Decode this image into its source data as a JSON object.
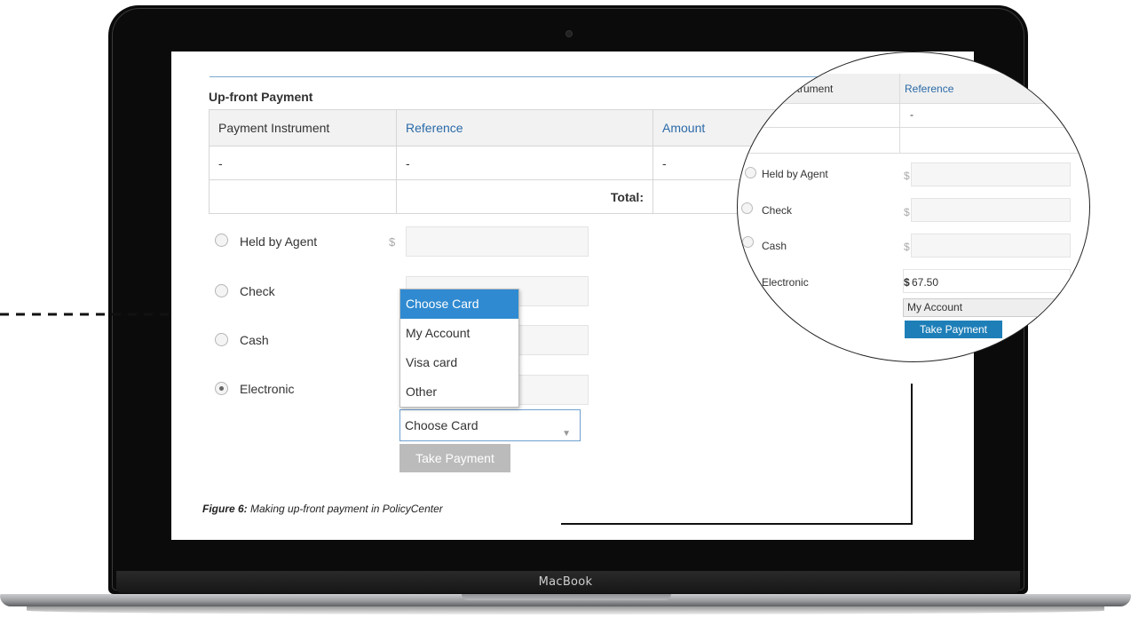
{
  "device": {
    "brand_label": "MacBook"
  },
  "section": {
    "title": "Up-front Payment"
  },
  "table": {
    "headers": [
      "Payment Instrument",
      "Reference",
      "Amount"
    ],
    "row": [
      "-",
      "-",
      "-"
    ],
    "total_label": "Total:"
  },
  "methods": [
    {
      "label": "Held by Agent",
      "currency": "$",
      "checked": false
    },
    {
      "label": "Check",
      "currency": "$",
      "checked": false
    },
    {
      "label": "Cash",
      "currency": "$",
      "checked": false
    },
    {
      "label": "Electronic",
      "currency": "$",
      "checked": true
    }
  ],
  "card_select": {
    "value": "Choose Card",
    "options": [
      "Choose Card",
      "My Account",
      "Visa card",
      "Other"
    ]
  },
  "take_payment_label": "Take Payment",
  "caption": {
    "prefix": "Figure 6:",
    "text": " Making up-front payment in PolicyCenter"
  },
  "zoom": {
    "col_instrument_fragment": "nstrument",
    "col_reference": "Reference",
    "row_value": "-",
    "methods": [
      "Held by Agent",
      "Check",
      "Cash",
      "Electronic"
    ],
    "currency": "$",
    "electronic_amount": "67.50",
    "electronic_currency": "$",
    "selected_card": "My Account",
    "take_payment_label": "Take Payment"
  },
  "colors": {
    "accent": "#2f8ad1",
    "button_active": "#1e7fb8",
    "button_disabled": "#bbbbbb",
    "link": "#2a6aa8"
  }
}
